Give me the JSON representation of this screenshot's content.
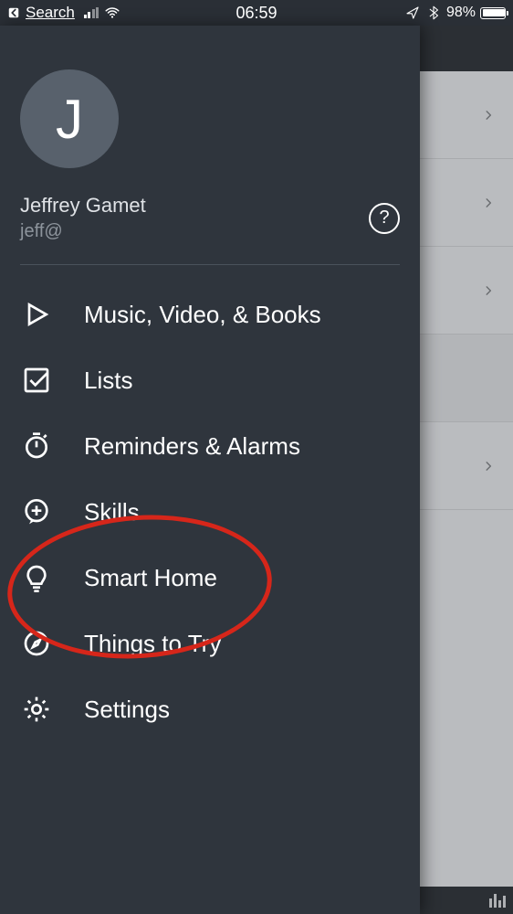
{
  "status": {
    "back_label": "Search",
    "time": "06:59",
    "battery_pct": "98%"
  },
  "user": {
    "initial": "J",
    "name": "Jeffrey Gamet",
    "email": "jeff@",
    "help": "?"
  },
  "menu": {
    "items": [
      {
        "icon": "play-icon",
        "label": "Music, Video, & Books"
      },
      {
        "icon": "checkbox-icon",
        "label": "Lists"
      },
      {
        "icon": "stopwatch-icon",
        "label": "Reminders & Alarms"
      },
      {
        "icon": "speech-plus-icon",
        "label": "Skills"
      },
      {
        "icon": "lightbulb-icon",
        "label": "Smart Home"
      },
      {
        "icon": "compass-icon",
        "label": "Things to Try"
      },
      {
        "icon": "gear-icon",
        "label": "Settings"
      }
    ]
  },
  "annotation": {
    "circled_item": "Smart Home"
  }
}
